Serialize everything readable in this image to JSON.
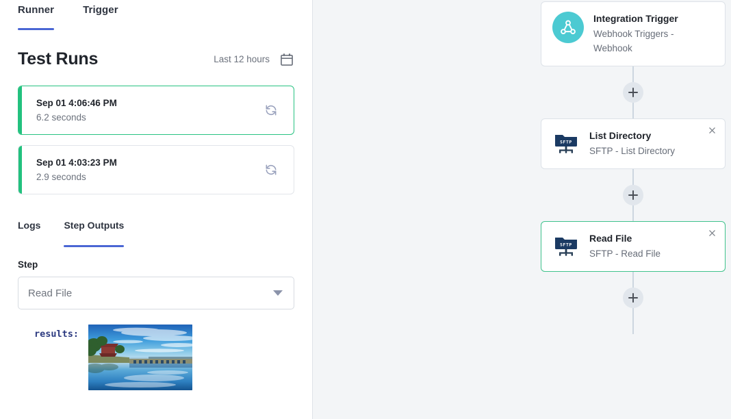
{
  "left_panel": {
    "tabs": [
      {
        "label": "Runner",
        "active": true
      },
      {
        "label": "Trigger",
        "active": false
      }
    ],
    "section_title": "Test Runs",
    "time_range_label": "Last 12 hours",
    "calendar_icon": "calendar-icon",
    "runs": [
      {
        "timestamp": "Sep 01 4:06:46 PM",
        "duration": "6.2 seconds",
        "status_color": "#22c17e",
        "selected": true,
        "retry_icon": "refresh-icon"
      },
      {
        "timestamp": "Sep 01 4:03:23 PM",
        "duration": "2.9 seconds",
        "status_color": "#22c17e",
        "selected": false,
        "retry_icon": "refresh-icon"
      }
    ],
    "sub_tabs": [
      {
        "label": "Logs",
        "active": false
      },
      {
        "label": "Step Outputs",
        "active": true
      }
    ],
    "step_field": {
      "label": "Step",
      "value": "Read File",
      "caret_icon": "chevron-down-icon"
    },
    "output": {
      "key": "results:",
      "image_alt": "landscape photo of a chinese pavilion and seventeen arch stone bridge over calm water"
    }
  },
  "canvas": {
    "background_color": "#f3f5f7",
    "connector_color": "#ccd6e0",
    "add_button_icon": "plus-icon",
    "nodes": [
      {
        "title": "Integration Trigger",
        "subtitle": "Webhook Triggers - Webhook",
        "icon": "webhook-icon",
        "icon_color": "#4ccad2",
        "selected": false,
        "closable": false
      },
      {
        "title": "List Directory",
        "subtitle": "SFTP - List Directory",
        "icon": "sftp-folder-icon",
        "icon_color": "#1b3a63",
        "selected": false,
        "closable": true,
        "close_icon": "close-icon"
      },
      {
        "title": "Read File",
        "subtitle": "SFTP - Read File",
        "icon": "sftp-folder-icon",
        "icon_color": "#1b3a63",
        "selected": true,
        "closable": true,
        "close_icon": "close-icon"
      }
    ]
  },
  "colors": {
    "accent_blue": "#4a66d4",
    "success_green": "#22c17e",
    "selected_node_green": "#3fc28c",
    "trigger_teal": "#4ccad2",
    "sftp_navy": "#1b3a63",
    "text_primary": "#20242b",
    "text_secondary": "#6b717c"
  }
}
